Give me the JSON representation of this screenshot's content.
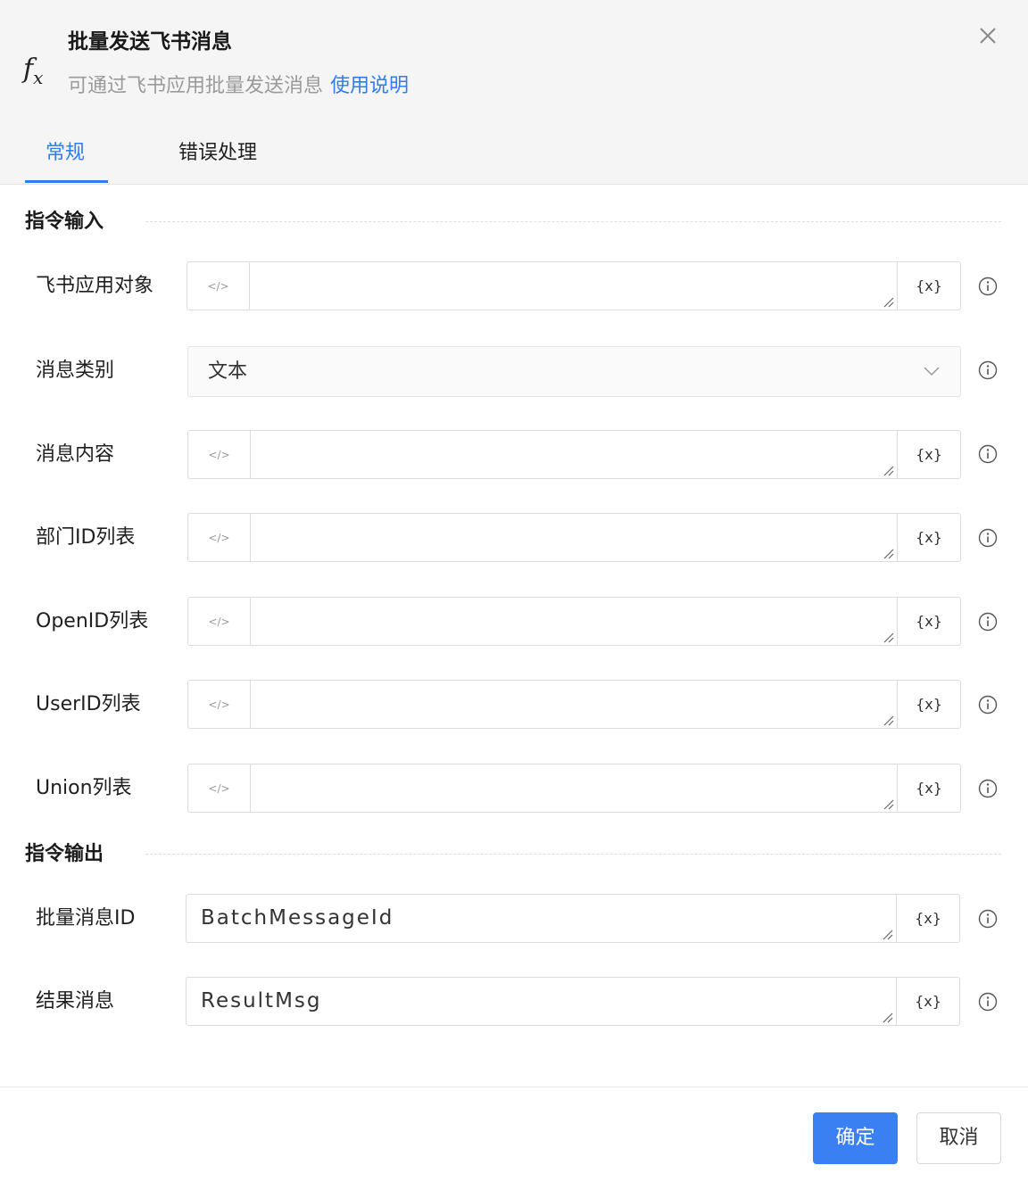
{
  "header": {
    "fx_symbol": "f",
    "fx_sub": "x",
    "title": "批量发送飞书消息",
    "subtitle": "可通过飞书应用批量发送消息",
    "help_link": "使用说明"
  },
  "tabs": [
    {
      "label": "常规",
      "active": true
    },
    {
      "label": "错误处理",
      "active": false
    }
  ],
  "input_section": {
    "title": "指令输入",
    "fields": [
      {
        "label": "飞书应用对象",
        "value": ""
      },
      {
        "label": "消息类别",
        "value": "文本",
        "type": "select"
      },
      {
        "label": "消息内容",
        "value": ""
      },
      {
        "label": "部门ID列表",
        "value": ""
      },
      {
        "label": "OpenID列表",
        "value": ""
      },
      {
        "label": "UserID列表",
        "value": ""
      },
      {
        "label": "Union列表",
        "value": ""
      }
    ]
  },
  "output_section": {
    "title": "指令输出",
    "fields": [
      {
        "label": "批量消息ID",
        "value": "BatchMessageId"
      },
      {
        "label": "结果消息",
        "value": "ResultMsg"
      }
    ]
  },
  "var_button_label": "{x}",
  "code_button_label": "</>",
  "footer": {
    "confirm": "确定",
    "cancel": "取消"
  },
  "colors": {
    "accent": "#2f7cf5",
    "header_bg": "#f5f5f5"
  }
}
